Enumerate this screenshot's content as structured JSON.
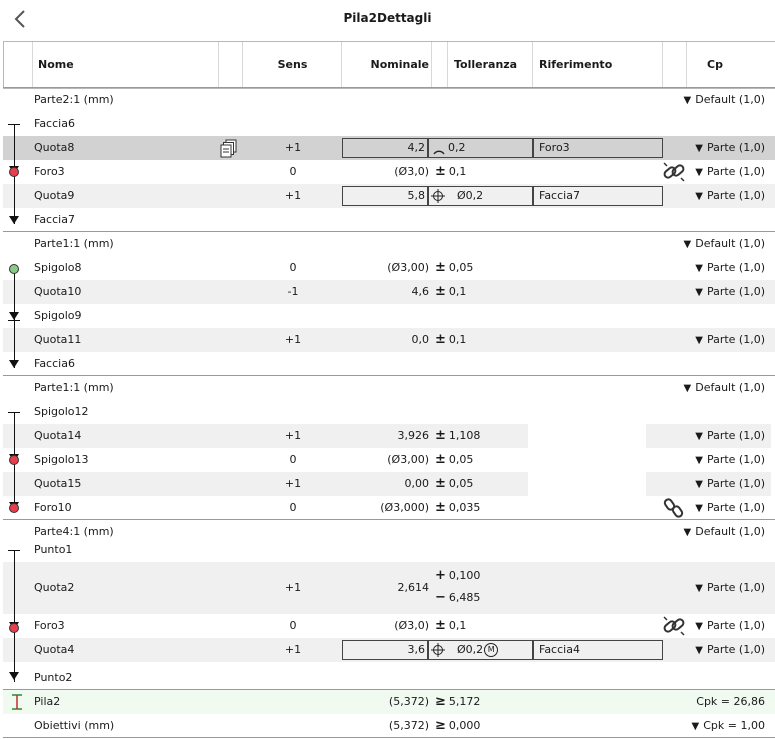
{
  "title": "Pila2Dettagli",
  "columns": {
    "nome": "Nome",
    "sens": "Sens",
    "nominale": "Nominale",
    "tolleranza": "Tolleranza",
    "riferimento": "Riferimento",
    "cp": "Cp"
  },
  "groups": [
    {
      "header": {
        "label": "Parte2:1 (mm)",
        "cp": "Default (1,0)"
      },
      "rows": [
        {
          "name": "Faccia6"
        },
        {
          "name": "Quota8",
          "sens": "+1",
          "nominal": "4,2",
          "tol": "0,2",
          "tol_symbol": "arc",
          "ref": "Foro3",
          "cp": "Parte (1,0)"
        },
        {
          "name": "Foro3",
          "sens": "0",
          "nominal": "(Ø3,0)",
          "tol": "0,1",
          "cp": "Parte (1,0)"
        },
        {
          "name": "Quota9",
          "sens": "+1",
          "nominal": "5,8",
          "tol": "0,2",
          "tol_symbol": "position",
          "ref": "Faccia7",
          "cp": "Parte (1,0)"
        },
        {
          "name": "Faccia7"
        }
      ]
    },
    {
      "header": {
        "label": "Parte1:1 (mm)",
        "cp": "Default (1,0)"
      },
      "rows": [
        {
          "name": "Spigolo8",
          "sens": "0",
          "nominal": "(Ø3,00)",
          "tol": "0,05",
          "cp": "Parte (1,0)"
        },
        {
          "name": "Quota10",
          "sens": "-1",
          "nominal": "4,6",
          "tol": "0,1",
          "cp": "Parte (1,0)"
        },
        {
          "name": "Spigolo9"
        },
        {
          "name": "Quota11",
          "sens": "+1",
          "nominal": "0,0",
          "tol": "0,1",
          "cp": "Parte (1,0)"
        },
        {
          "name": "Faccia6"
        }
      ]
    },
    {
      "header": {
        "label": "Parte1:1 (mm)",
        "cp": "Default (1,0)"
      },
      "rows": [
        {
          "name": "Spigolo12"
        },
        {
          "name": "Quota14",
          "sens": "+1",
          "nominal": "3,926",
          "tol": "1,108",
          "cp": "Parte (1,0)"
        },
        {
          "name": "Spigolo13",
          "sens": "0",
          "nominal": "(Ø3,00)",
          "tol": "0,05",
          "cp": "Parte (1,0)"
        },
        {
          "name": "Quota15",
          "sens": "+1",
          "nominal": "0,00",
          "tol": "0,05",
          "cp": "Parte (1,0)"
        },
        {
          "name": "Foro10",
          "sens": "0",
          "nominal": "(Ø3,000)",
          "tol": "0,035",
          "cp": "Parte (1,0)"
        }
      ]
    },
    {
      "header": {
        "label": "Parte4:1 (mm)",
        "cp": "Default (1,0)"
      },
      "rows": [
        {
          "name": "Punto1"
        },
        {
          "name": "Quota2",
          "sens": "+1",
          "nominal": "2,614",
          "tol_plus": "0,100",
          "tol_minus": "6,485",
          "cp": "Parte (1,0)"
        },
        {
          "name": "Foro3",
          "sens": "0",
          "nominal": "(Ø3,0)",
          "tol": "0,1",
          "cp": "Parte (1,0)"
        },
        {
          "name": "Quota4",
          "sens": "+1",
          "nominal": "3,6",
          "tol": "0,2",
          "tol_symbol": "position",
          "modifier": "M",
          "ref": "Faccia4",
          "cp": "Parte (1,0)"
        },
        {
          "name": "Punto2"
        }
      ]
    }
  ],
  "summary": [
    {
      "name": "Pila2",
      "nominal": "(5,372)",
      "tol": "5,172",
      "cp": "Cpk = 26,86"
    },
    {
      "name": "Obiettivi (mm)",
      "nominal": "(5,372)",
      "tol": "0,000",
      "cp": "Cpk = 1,00"
    }
  ],
  "symbols": {
    "plus_minus": "±",
    "ge": "≥",
    "diameter": "Ø",
    "plus": "+",
    "minus": "−"
  },
  "icons": [
    "back-chevron-icon",
    "copy-pages-icon",
    "chain-link-icon",
    "broken-link-icon",
    "triangle-down-icon",
    "position-symbol-icon",
    "arc-profile-icon",
    "dimension-arrow-icon"
  ],
  "colors": {
    "selected_row": "#d2d2d2",
    "alt_row": "#f0f0f0",
    "red_dot": "#e8404b",
    "green_dot": "#8cc888",
    "summary_row": "#f0faf0"
  }
}
